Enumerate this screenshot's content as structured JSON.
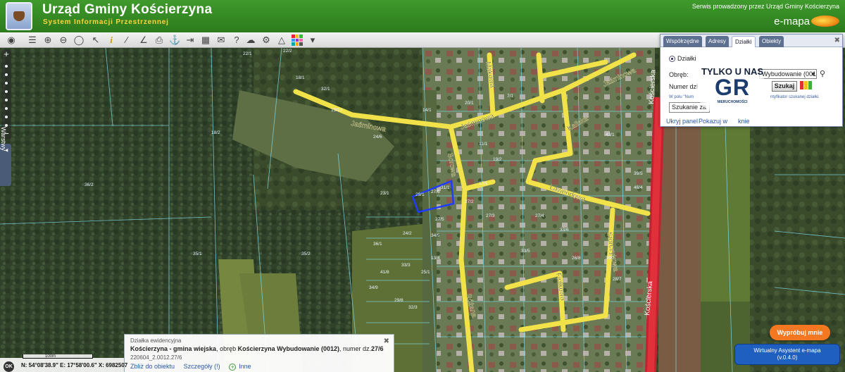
{
  "header": {
    "title": "Urząd Gminy Kościerzyna",
    "subtitle": "System Informacji Przestrzennej",
    "service_note": "Serwis prowadzony przez Urząd Gminy Kościerzyna",
    "brand": "e-mapa"
  },
  "toolbar": {
    "tools": [
      "layers",
      "zoom-in",
      "zoom-out",
      "zoom-extent",
      "select",
      "info",
      "measure-distance",
      "measure-area",
      "print",
      "anchor",
      "export",
      "layout",
      "comment",
      "help",
      "cloud",
      "settings",
      "warning",
      "colors"
    ]
  },
  "zoom": {
    "plus": "+",
    "minus": "−"
  },
  "layers_tab": "Warstwy",
  "search_panel": {
    "tabs": [
      "Współrzędne",
      "Adresy",
      "Działki",
      "Obiekty"
    ],
    "active_tab": "Działki",
    "radio_label": "Działki",
    "obreb_label": "Obręb:",
    "obreb_value": "Wybudowanie (0012)",
    "numer_label": "Numer dzi",
    "search_button": "Szukaj",
    "hint_left": "W polu \"Num",
    "hint_right": "ntyfikator szukanej działki.",
    "search_text": "Szukanie za",
    "links": [
      "Ukryj panel",
      "Pokazuj w",
      "okno",
      "knie"
    ]
  },
  "ad": {
    "top": "TYLKO U NAS",
    "logo": "GR",
    "sub": "NIERUCHOMOŚCI"
  },
  "streets": {
    "jasminowa": "Jaśminowa",
    "jasminowa_2": "Jaśminowa",
    "jasminowa_3": "Jaśminowa",
    "kaliska": "Kaliska",
    "lawendowa": "Lawendowa",
    "borowa": "Borowa",
    "koscierska": "Kościerska",
    "kocierska_2": "Kościerska",
    "makowa": "Makowa",
    "storczykowa": "Storczykowa",
    "rozana": "Różana",
    "fiolkowa": "Fiołkowa"
  },
  "parcels": [
    "22/1",
    "22/2",
    "18/1",
    "32/1",
    "18/2",
    "13/12",
    "24/6",
    "29/1",
    "31/1",
    "27/6",
    "27/5",
    "23/1",
    "24/2",
    "34/5",
    "36/2",
    "35/1",
    "35/2",
    "36/1",
    "33/3",
    "41/8",
    "34/9",
    "29/8",
    "25/1",
    "13/4",
    "14/1",
    "11/1",
    "7/1",
    "20/1",
    "17/1",
    "19/2",
    "43/1",
    "46/4",
    "32/3",
    "27/2",
    "27/3",
    "27/4",
    "26/8",
    "33/5",
    "33/6",
    "30/7",
    "39/5",
    "28/7"
  ],
  "selected_parcel": "27/6",
  "info": {
    "head": "Działka ewidencyjna",
    "gmina": "Kościerzyna - gmina wiejska",
    "obreb_word": ", obręb ",
    "obreb": "Kościerzyna Wybudowanie (0012)",
    "numer_word": ", numer dz.",
    "numer": "27/6",
    "code": "220604_2.0012.27/6",
    "link_zoom": "Zbliż do obiektu",
    "link_details": "Szczegóły (!)",
    "link_other": "Inne"
  },
  "status": {
    "ok": "OK",
    "scale": "100m",
    "coords": "N: 54°08'38.9\"  E: 17°58'00.6\"   X: 6982507"
  },
  "buttons": {
    "try": "Wypróbuj mnie",
    "assistant_line1": "Wirtualny Asystent e-mapa",
    "assistant_line2": "(v.0.4.0)"
  },
  "colors": {
    "header_green": "#2e8b1f",
    "road_yellow": "#f2e24a",
    "highlight_blue": "#1f3cff",
    "main_road_red": "#e0303a"
  }
}
